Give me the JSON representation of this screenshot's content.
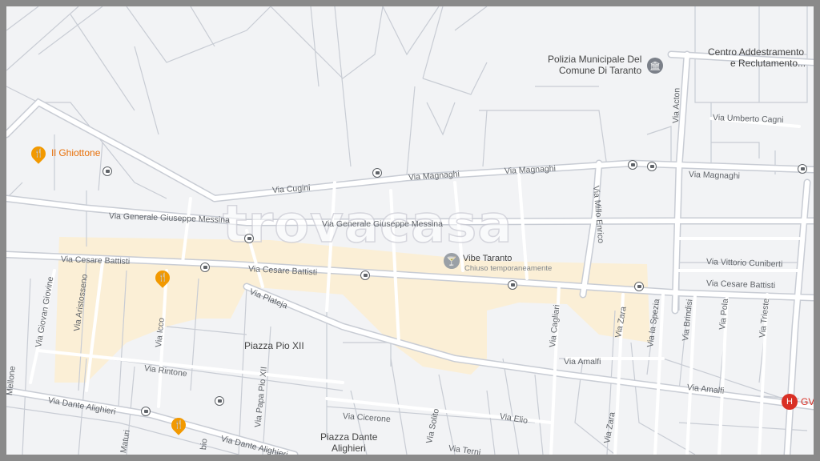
{
  "map": {
    "watermark": "trovacasa",
    "pois": {
      "polizia": {
        "line1": "Polizia Municipale Del",
        "line2": "Comune Di Taranto",
        "icon": "government-building-icon"
      },
      "centro": {
        "line1": "Centro Addestramento",
        "line2": "e Reclutamento..."
      },
      "ghiottone": {
        "name": "Il Ghiottone",
        "icon": "restaurant-icon"
      },
      "vibe": {
        "name": "Vibe Taranto",
        "status": "Chiuso temporaneamente",
        "icon": "cocktail-bar-icon"
      },
      "piazza_pio": {
        "name": "Piazza Pio XII"
      },
      "piazza_dante": {
        "line1": "Piazza Dante",
        "line2": "Alighieri"
      },
      "hospital": {
        "name": "GV",
        "icon": "hospital-icon"
      }
    },
    "streets": {
      "cugini": "Via Cugini",
      "magnaghi_1": "Via Magnaghi",
      "magnaghi_2": "Via Magnaghi",
      "magnaghi_3": "Via Magnaghi",
      "messina_1": "Via Generale Giuseppe Messina",
      "messina_2": "Via Generale Giuseppe Messina",
      "battisti_1": "Via Cesare Battisti",
      "battisti_2": "Via Cesare Battisti",
      "battisti_3": "Via Cesare Battisti",
      "umberto": "Via Umberto Cagni",
      "acton": "Via Acton",
      "millo": "Via Millo Enrico",
      "cuniberti": "Via Vittorio Cuniberti",
      "giovine": "Via Giovan Giovine",
      "aristosseno": "Via Aristosseno",
      "icco": "Via Icco",
      "plateja": "Via Plateja",
      "rintone": "Via Rintone",
      "papa_pio": "Via Papa Pio XII",
      "dante_1": "Via Dante Alighieri",
      "dante_2": "Via Dante Alighieri",
      "cicerone": "Via Cicerone",
      "elio": "Via Elio",
      "solito": "Via Solito",
      "terni": "Via Terni",
      "cagliari": "Via Cagliari",
      "zara_1": "Via Zara",
      "zara_2": "Via Zara",
      "spezia": "Via la Spezia",
      "brindisi": "Via Brindisi",
      "pola": "Via Pola",
      "trieste": "Via Trieste",
      "amalfi_1": "Via Amalfi",
      "amalfi_2": "Via Amalfi",
      "maturi": "Maturi",
      "bio": "bio",
      "mellone": "Mellone"
    },
    "colors": {
      "background": "#f2f3f5",
      "road": "#ffffff",
      "road_outline": "#c8ccd4",
      "highlight_area": "#fbefd6",
      "restaurant": "#f29900",
      "hospital": "#d93025"
    }
  }
}
